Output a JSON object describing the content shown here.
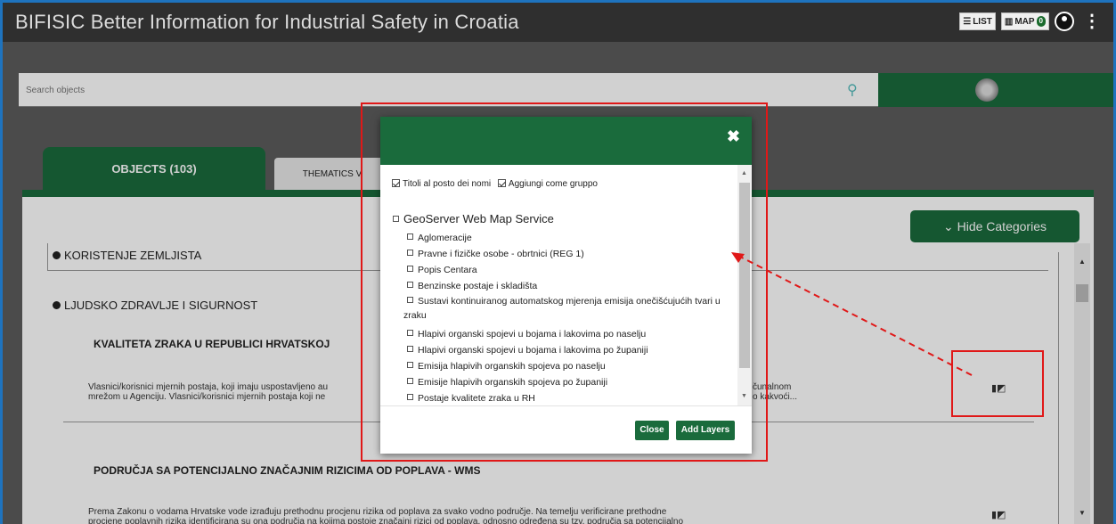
{
  "app": {
    "title": "BIFISIC Better Information for Industrial Safety in Croatia"
  },
  "topbar": {
    "list_label": "LIST",
    "map_label": "MAP",
    "map_count": "0",
    "menu_glyph": "⋮"
  },
  "search": {
    "placeholder": "Search objects"
  },
  "tabs": {
    "objects": "OBJECTS (103)",
    "thematics": "THEMATICS V"
  },
  "hide_categories": "⌄ Hide Categories",
  "categories": [
    {
      "label": "KORISTENJE ZEMLJISTA"
    },
    {
      "label": "LJUDSKO ZDRAVLJE I SIGURNOST"
    }
  ],
  "items": [
    {
      "title": "KVALITETA ZRAKA U REPUBLICI HRVATSKOJ",
      "desc_line1": "Vlasnici/korisnici mjernih postaja, koji imaju uspostavljeno au",
      "desc_line2": "mrežom u Agenciju. Vlasnici/korisnici mjernih postaja koji ne",
      "desc_right1": "čunalnom",
      "desc_right2": "o kakvoći..."
    },
    {
      "title": "PODRUČJA SA POTENCIJALNO ZNAČAJNIM RIZICIMA OD POPLAVA - WMS",
      "desc_line1": "Prema Zakonu o vodama Hrvatske vode izrađuju prethodnu procjenu rizika od poplava za svako vodno područje. Na temelju verificirane prethodne",
      "desc_line2": "procjene poplavnih rizika identificirana su ona područja na kojima postoje značajni rizici od poplava, odnosno određena su tzv. područja sa potencijalno"
    }
  ],
  "modal": {
    "close_glyph": "✖",
    "opt_titles": "Titoli al posto dei nomi",
    "opt_group": "Aggiungi come gruppo",
    "service": "GeoServer Web Map Service",
    "layers": [
      "Aglomeracije",
      "Pravne i fizičke osobe - obrtnici (REG 1)",
      "Popis Centara",
      "Benzinske postaje i skladišta",
      "Sustavi kontinuiranog automatskog mjerenja emisija onečišćujućih tvari u zraku",
      "Hlapivi organski spojevi u bojama i lakovima po naselju",
      "Hlapivi organski spojevi u bojama i lakovima po županiji",
      "Emisija hlapivih organskih spojeva po naselju",
      "Emisije hlapivih organskih spojeva po županiji",
      "Postaje kvalitete zraka u RH"
    ],
    "btn_close": "Close",
    "btn_add": "Add Layers"
  }
}
